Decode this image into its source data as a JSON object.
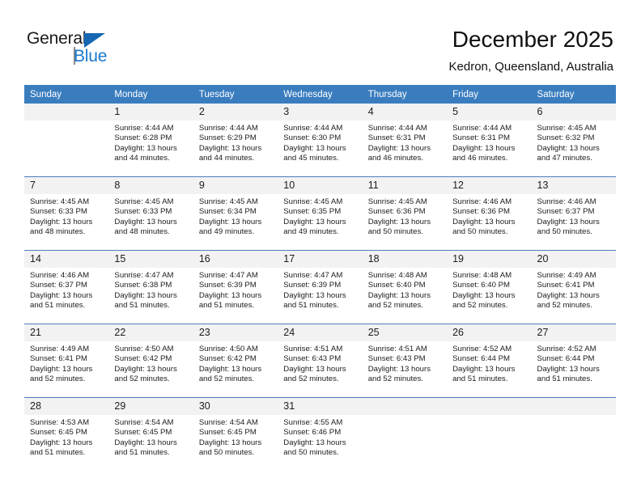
{
  "brand": {
    "name_primary": "General",
    "name_secondary": "Blue",
    "accent_color": "#1979ce",
    "triangle_color": "#1567b4"
  },
  "header": {
    "title": "December 2025",
    "subtitle": "Kedron, Queensland, Australia"
  },
  "theme": {
    "header_row_bg": "#3a7dbf",
    "daynum_bg": "#f2f2f2",
    "week_border": "#4a7ebb",
    "text_color": "#1c1c1c"
  },
  "weekday_headers": [
    "Sunday",
    "Monday",
    "Tuesday",
    "Wednesday",
    "Thursday",
    "Friday",
    "Saturday"
  ],
  "weeks": [
    [
      {
        "day": "",
        "sunrise": "",
        "sunset": "",
        "daylight": ""
      },
      {
        "day": "1",
        "sunrise": "Sunrise: 4:44 AM",
        "sunset": "Sunset: 6:28 PM",
        "daylight": "Daylight: 13 hours and 44 minutes."
      },
      {
        "day": "2",
        "sunrise": "Sunrise: 4:44 AM",
        "sunset": "Sunset: 6:29 PM",
        "daylight": "Daylight: 13 hours and 44 minutes."
      },
      {
        "day": "3",
        "sunrise": "Sunrise: 4:44 AM",
        "sunset": "Sunset: 6:30 PM",
        "daylight": "Daylight: 13 hours and 45 minutes."
      },
      {
        "day": "4",
        "sunrise": "Sunrise: 4:44 AM",
        "sunset": "Sunset: 6:31 PM",
        "daylight": "Daylight: 13 hours and 46 minutes."
      },
      {
        "day": "5",
        "sunrise": "Sunrise: 4:44 AM",
        "sunset": "Sunset: 6:31 PM",
        "daylight": "Daylight: 13 hours and 46 minutes."
      },
      {
        "day": "6",
        "sunrise": "Sunrise: 4:45 AM",
        "sunset": "Sunset: 6:32 PM",
        "daylight": "Daylight: 13 hours and 47 minutes."
      }
    ],
    [
      {
        "day": "7",
        "sunrise": "Sunrise: 4:45 AM",
        "sunset": "Sunset: 6:33 PM",
        "daylight": "Daylight: 13 hours and 48 minutes."
      },
      {
        "day": "8",
        "sunrise": "Sunrise: 4:45 AM",
        "sunset": "Sunset: 6:33 PM",
        "daylight": "Daylight: 13 hours and 48 minutes."
      },
      {
        "day": "9",
        "sunrise": "Sunrise: 4:45 AM",
        "sunset": "Sunset: 6:34 PM",
        "daylight": "Daylight: 13 hours and 49 minutes."
      },
      {
        "day": "10",
        "sunrise": "Sunrise: 4:45 AM",
        "sunset": "Sunset: 6:35 PM",
        "daylight": "Daylight: 13 hours and 49 minutes."
      },
      {
        "day": "11",
        "sunrise": "Sunrise: 4:45 AM",
        "sunset": "Sunset: 6:36 PM",
        "daylight": "Daylight: 13 hours and 50 minutes."
      },
      {
        "day": "12",
        "sunrise": "Sunrise: 4:46 AM",
        "sunset": "Sunset: 6:36 PM",
        "daylight": "Daylight: 13 hours and 50 minutes."
      },
      {
        "day": "13",
        "sunrise": "Sunrise: 4:46 AM",
        "sunset": "Sunset: 6:37 PM",
        "daylight": "Daylight: 13 hours and 50 minutes."
      }
    ],
    [
      {
        "day": "14",
        "sunrise": "Sunrise: 4:46 AM",
        "sunset": "Sunset: 6:37 PM",
        "daylight": "Daylight: 13 hours and 51 minutes."
      },
      {
        "day": "15",
        "sunrise": "Sunrise: 4:47 AM",
        "sunset": "Sunset: 6:38 PM",
        "daylight": "Daylight: 13 hours and 51 minutes."
      },
      {
        "day": "16",
        "sunrise": "Sunrise: 4:47 AM",
        "sunset": "Sunset: 6:39 PM",
        "daylight": "Daylight: 13 hours and 51 minutes."
      },
      {
        "day": "17",
        "sunrise": "Sunrise: 4:47 AM",
        "sunset": "Sunset: 6:39 PM",
        "daylight": "Daylight: 13 hours and 51 minutes."
      },
      {
        "day": "18",
        "sunrise": "Sunrise: 4:48 AM",
        "sunset": "Sunset: 6:40 PM",
        "daylight": "Daylight: 13 hours and 52 minutes."
      },
      {
        "day": "19",
        "sunrise": "Sunrise: 4:48 AM",
        "sunset": "Sunset: 6:40 PM",
        "daylight": "Daylight: 13 hours and 52 minutes."
      },
      {
        "day": "20",
        "sunrise": "Sunrise: 4:49 AM",
        "sunset": "Sunset: 6:41 PM",
        "daylight": "Daylight: 13 hours and 52 minutes."
      }
    ],
    [
      {
        "day": "21",
        "sunrise": "Sunrise: 4:49 AM",
        "sunset": "Sunset: 6:41 PM",
        "daylight": "Daylight: 13 hours and 52 minutes."
      },
      {
        "day": "22",
        "sunrise": "Sunrise: 4:50 AM",
        "sunset": "Sunset: 6:42 PM",
        "daylight": "Daylight: 13 hours and 52 minutes."
      },
      {
        "day": "23",
        "sunrise": "Sunrise: 4:50 AM",
        "sunset": "Sunset: 6:42 PM",
        "daylight": "Daylight: 13 hours and 52 minutes."
      },
      {
        "day": "24",
        "sunrise": "Sunrise: 4:51 AM",
        "sunset": "Sunset: 6:43 PM",
        "daylight": "Daylight: 13 hours and 52 minutes."
      },
      {
        "day": "25",
        "sunrise": "Sunrise: 4:51 AM",
        "sunset": "Sunset: 6:43 PM",
        "daylight": "Daylight: 13 hours and 52 minutes."
      },
      {
        "day": "26",
        "sunrise": "Sunrise: 4:52 AM",
        "sunset": "Sunset: 6:44 PM",
        "daylight": "Daylight: 13 hours and 51 minutes."
      },
      {
        "day": "27",
        "sunrise": "Sunrise: 4:52 AM",
        "sunset": "Sunset: 6:44 PM",
        "daylight": "Daylight: 13 hours and 51 minutes."
      }
    ],
    [
      {
        "day": "28",
        "sunrise": "Sunrise: 4:53 AM",
        "sunset": "Sunset: 6:45 PM",
        "daylight": "Daylight: 13 hours and 51 minutes."
      },
      {
        "day": "29",
        "sunrise": "Sunrise: 4:54 AM",
        "sunset": "Sunset: 6:45 PM",
        "daylight": "Daylight: 13 hours and 51 minutes."
      },
      {
        "day": "30",
        "sunrise": "Sunrise: 4:54 AM",
        "sunset": "Sunset: 6:45 PM",
        "daylight": "Daylight: 13 hours and 50 minutes."
      },
      {
        "day": "31",
        "sunrise": "Sunrise: 4:55 AM",
        "sunset": "Sunset: 6:46 PM",
        "daylight": "Daylight: 13 hours and 50 minutes."
      },
      {
        "day": "",
        "sunrise": "",
        "sunset": "",
        "daylight": ""
      },
      {
        "day": "",
        "sunrise": "",
        "sunset": "",
        "daylight": ""
      },
      {
        "day": "",
        "sunrise": "",
        "sunset": "",
        "daylight": ""
      }
    ]
  ]
}
